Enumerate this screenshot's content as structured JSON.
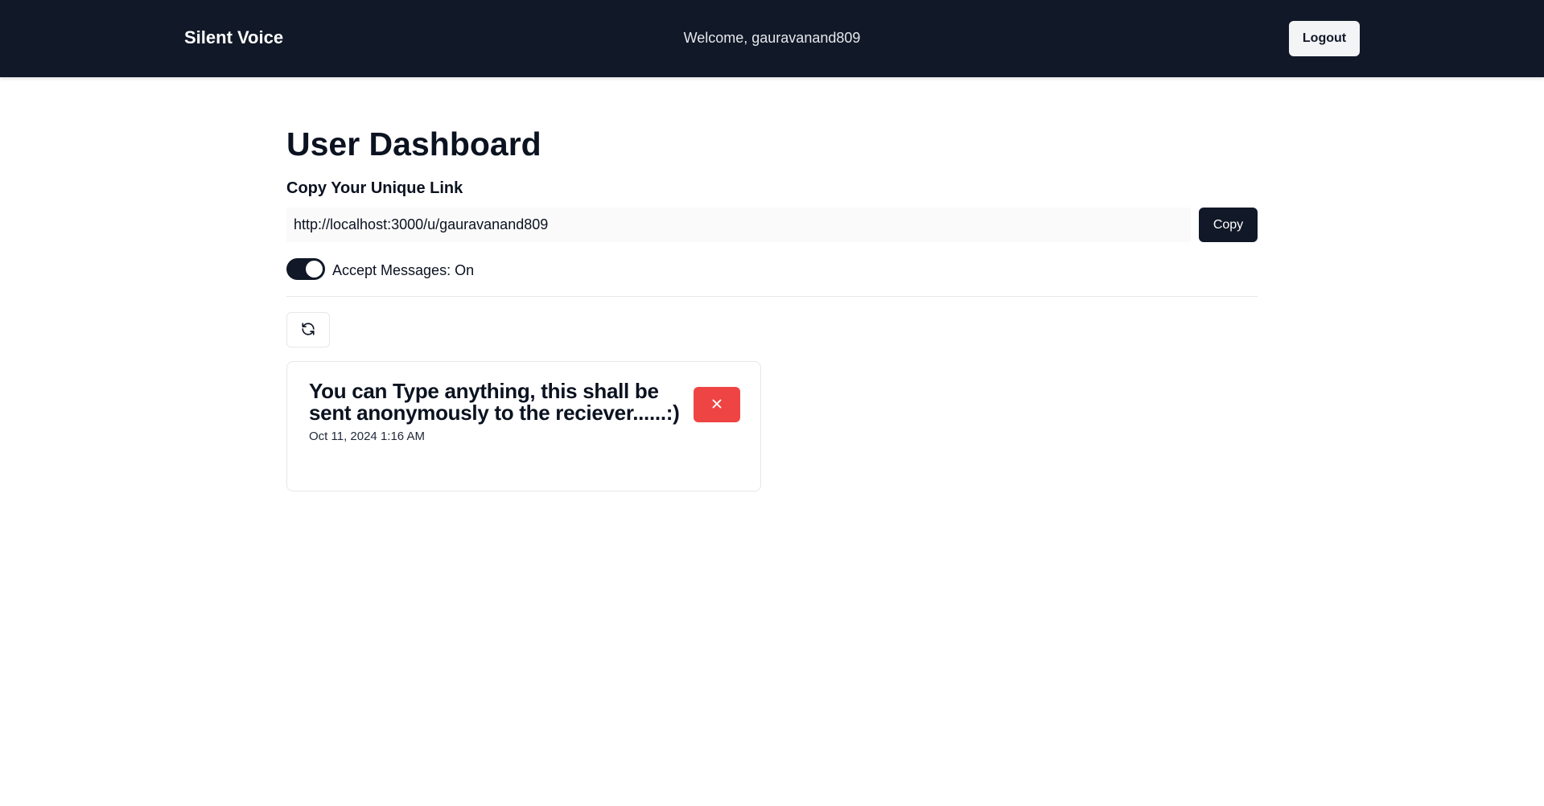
{
  "header": {
    "brand": "Silent Voice",
    "welcome": "Welcome, gauravanand809",
    "logout_label": "Logout"
  },
  "dashboard": {
    "title": "User Dashboard",
    "link_section_label": "Copy Your Unique Link",
    "unique_link": "http://localhost:3000/u/gauravanand809",
    "copy_label": "Copy",
    "accept_messages_label": "Accept Messages: On",
    "accept_messages": true
  },
  "messages": [
    {
      "content": "You can Type anything, this shall be sent anonymously to the reciever......:)",
      "date": "Oct 11, 2024 1:16 AM"
    }
  ],
  "icons": {
    "refresh": "refresh-icon",
    "delete": "close-icon"
  },
  "colors": {
    "navbar_bg": "#111827",
    "primary_button": "#111827",
    "delete_button": "#ef4444"
  }
}
